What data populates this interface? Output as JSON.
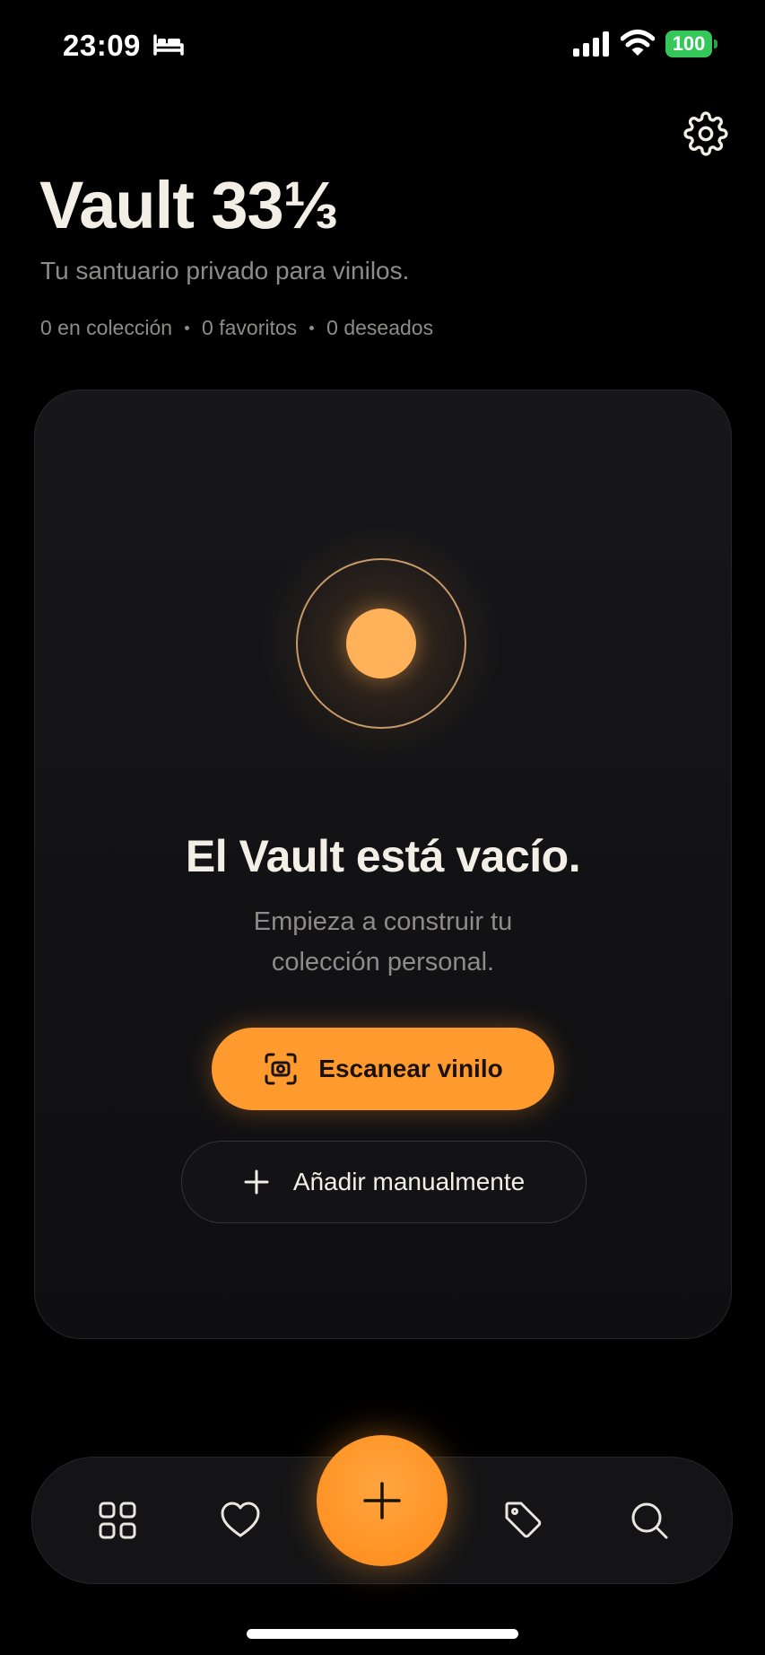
{
  "status_bar": {
    "time": "23:09",
    "battery": "100",
    "icons": [
      "bed-icon",
      "cellular-signal-icon",
      "wifi-icon",
      "battery-icon"
    ],
    "battery_color": "#34c759"
  },
  "header": {
    "title": "Vault 33⅓",
    "subtitle": "Tu santuario privado para vinilos.",
    "stats": [
      "0 en colección",
      "0 favoritos",
      "0 deseados"
    ],
    "settings_icon": "gear-icon"
  },
  "empty_state": {
    "title": "El Vault está vacío.",
    "description_lines": [
      "Empieza a construir tu",
      "colección personal."
    ],
    "scan_button": {
      "label": "Escanear vinilo",
      "icon": "scan-icon"
    },
    "manual_button": {
      "label": "Añadir manualmente",
      "icon": "plus-icon"
    },
    "illustration": "vinyl-record-icon"
  },
  "bottom_nav": {
    "items": [
      "grid-icon",
      "heart-icon",
      "add-icon",
      "tag-icon",
      "search-icon"
    ]
  },
  "colors": {
    "accent": "#ff9a2e",
    "background": "#000000",
    "card": "#141416",
    "text_primary": "#f3efe6",
    "text_secondary": "#8e8c88"
  }
}
